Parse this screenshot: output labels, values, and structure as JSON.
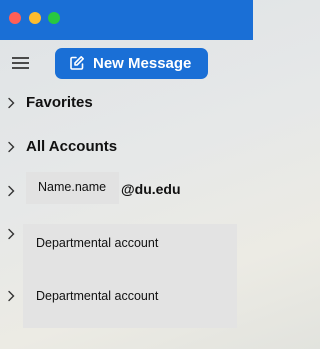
{
  "window": {
    "controls": [
      "close",
      "minimize",
      "maximize"
    ],
    "accent_color": "#1a6fd6"
  },
  "toolbar": {
    "menu_icon": "hamburger-icon",
    "new_message_label": "New Message",
    "new_message_icon": "compose-icon"
  },
  "folders": [
    {
      "label": "Favorites",
      "icon": "chevron-right-icon"
    },
    {
      "label": "All Accounts",
      "icon": "chevron-right-icon"
    }
  ],
  "account": {
    "name": "Name.name",
    "domain": "@du.edu"
  },
  "departmental": [
    {
      "label": "Departmental account"
    },
    {
      "label": "Departmental account"
    }
  ]
}
